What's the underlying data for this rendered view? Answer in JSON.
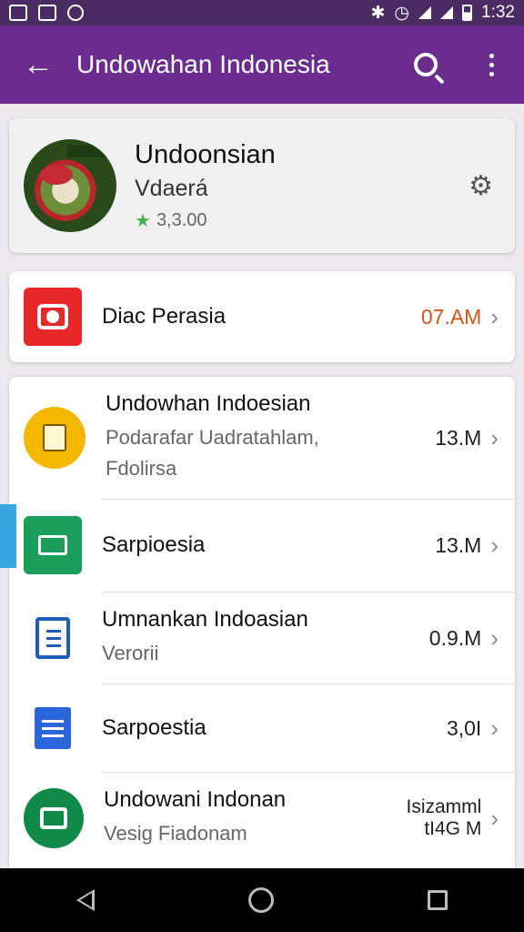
{
  "status_bar": {
    "time": "1:32",
    "left_icons": [
      "image-icon",
      "messenger-icon",
      "whatsapp-icon"
    ],
    "right_icons": [
      "bluetooth-icon",
      "alarm-icon",
      "signal-icon",
      "signal-icon",
      "battery-icon"
    ]
  },
  "app_bar": {
    "title": "Undowahan Indonesia",
    "back_icon": "arrow-left-icon",
    "search_icon": "search-icon",
    "menu_icon": "more-vert-icon",
    "color": "#6a2d8e"
  },
  "profile": {
    "name": "Undoonsian",
    "subtitle": "Vdaerá",
    "rating": "3,3.00",
    "settings_icon": "gear-icon"
  },
  "highlight_row": {
    "title": "Diac Perasia",
    "meta": "07.AM",
    "meta_color": "#d45512",
    "icon": "camera-icon"
  },
  "list": [
    {
      "title": "Undowhan Indoesian",
      "subtitle": "Podarafar Uadratahlam, Fdolirsa",
      "meta": "13.M",
      "icon": "document-icon"
    },
    {
      "title": "Sarpioesia",
      "subtitle": "",
      "meta": "13.M",
      "icon": "screen-icon"
    },
    {
      "title": "Umnankan Indoasian",
      "subtitle": "Verorii",
      "meta": "0.9.M",
      "icon": "clipboard-icon"
    },
    {
      "title": "Sarpoestia",
      "subtitle": "",
      "meta": "3,0I",
      "icon": "google-doc-icon"
    },
    {
      "title": "Undowani Indonan",
      "subtitle": "Vesig Fiadonam",
      "meta": "Isizamml tI4G M",
      "icon": "briefcase-icon"
    }
  ],
  "nav_bar": {
    "back": "nav-back-icon",
    "home": "nav-home-icon",
    "recent": "nav-recent-icon"
  }
}
